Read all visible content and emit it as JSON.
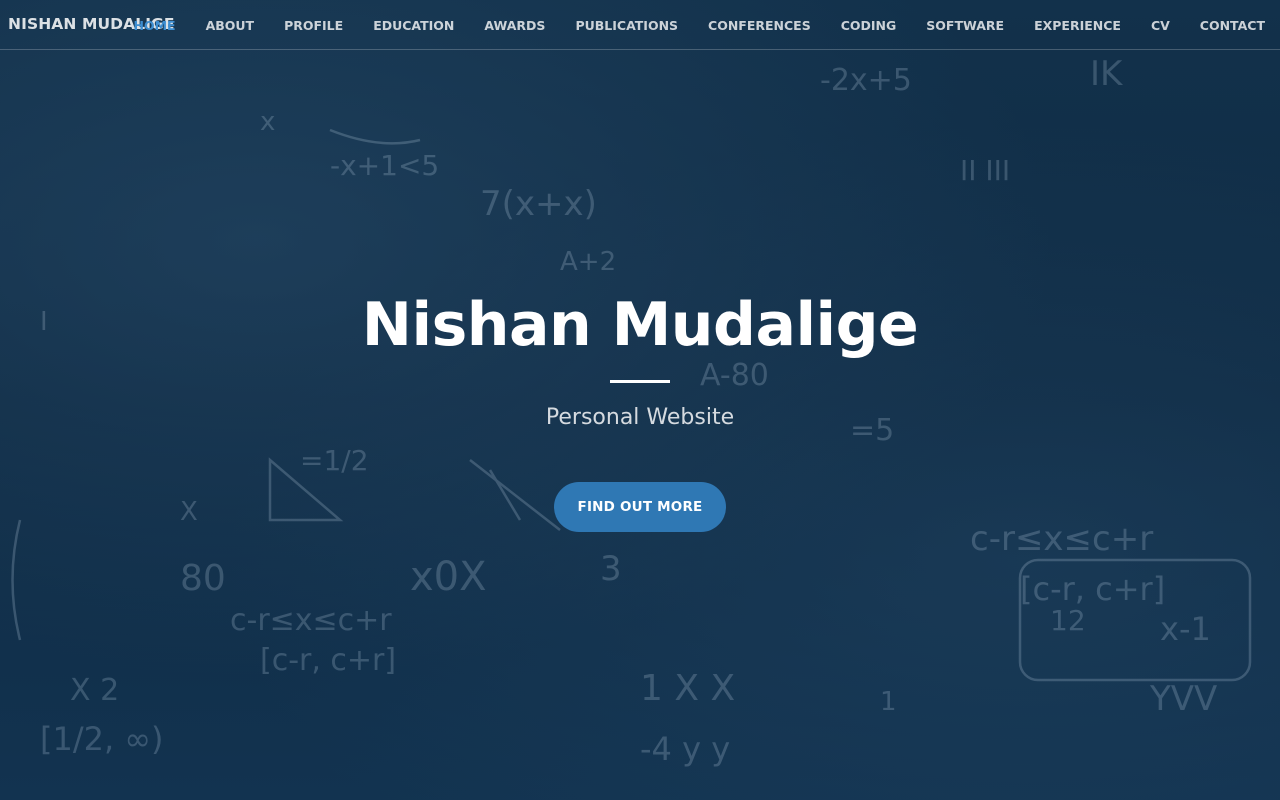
{
  "navbar": {
    "brand": "NISHAN MUDALIGE",
    "links": [
      {
        "label": "HOME",
        "active": true
      },
      {
        "label": "ABOUT",
        "active": false
      },
      {
        "label": "PROFILE",
        "active": false
      },
      {
        "label": "EDUCATION",
        "active": false
      },
      {
        "label": "AWARDS",
        "active": false
      },
      {
        "label": "PUBLICATIONS",
        "active": false
      },
      {
        "label": "CONFERENCES",
        "active": false
      },
      {
        "label": "CODING",
        "active": false
      },
      {
        "label": "SOFTWARE",
        "active": false
      },
      {
        "label": "EXPERIENCE",
        "active": false
      },
      {
        "label": "CV",
        "active": false
      },
      {
        "label": "CONTACT",
        "active": false
      }
    ]
  },
  "hero": {
    "title": "Nishan Mudalige",
    "subtitle": "Personal Website",
    "cta_label": "FIND OUT MORE"
  },
  "colors": {
    "background": "#102a42",
    "accent": "#3d8ed1",
    "button": "#2f78b4",
    "text": "#ffffff"
  }
}
